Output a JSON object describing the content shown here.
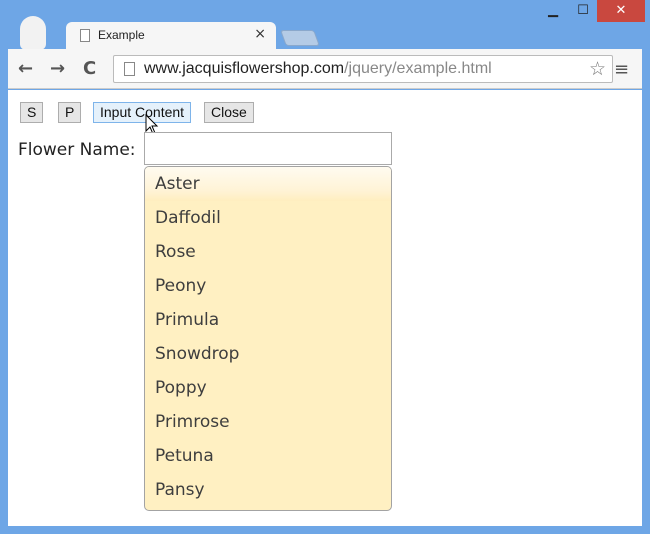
{
  "window": {
    "minimize_icon": "minimize-icon",
    "maximize_icon": "maximize-icon",
    "close_icon": "close-icon"
  },
  "tab": {
    "title": "Example",
    "close": "×"
  },
  "toolbar": {
    "back": "←",
    "forward": "→",
    "reload": "C",
    "url_host": "www.jacquisflowershop.com",
    "url_path": "/jquery/example.html",
    "star": "☆",
    "menu": "≡"
  },
  "buttons": [
    "S",
    "P",
    "Input Content",
    "Close"
  ],
  "form": {
    "label": "Flower Name:",
    "value": ""
  },
  "autocomplete": {
    "items": [
      "Aster",
      "Daffodil",
      "Rose",
      "Peony",
      "Primula",
      "Snowdrop",
      "Poppy",
      "Primrose",
      "Petuna",
      "Pansy"
    ],
    "active_index": 0,
    "background": "#fff0c2"
  }
}
